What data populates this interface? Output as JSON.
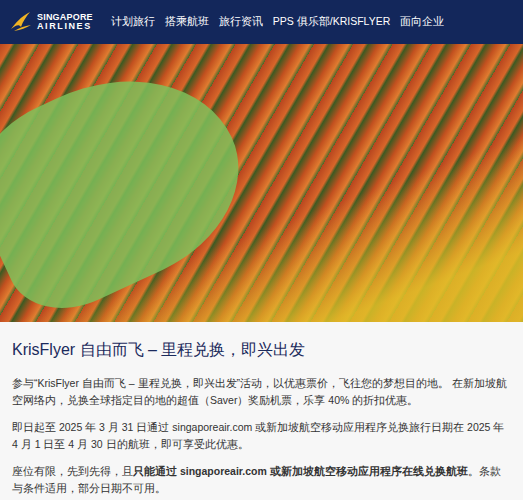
{
  "header": {
    "logo": {
      "line1": "SINGAPORE",
      "line2": "AIRLINES"
    },
    "nav": [
      "计划旅行",
      "搭乘航班",
      "旅行资讯",
      "PPS 俱乐部/KRISFLYER",
      "面向企业"
    ]
  },
  "article": {
    "title": "KrisFlyer 自由而飞 – 里程兑换，即兴出发",
    "paragraphs": [
      [
        {
          "text": "参与“KrisFlyer 自由而飞 – 里程兑换，即兴出发”活动，以优惠票价，飞往您的梦想目的地。 在新加坡航空网络内，兑换全球指定目的地的超值（Saver）奖励机票，乐享 40% 的折扣优惠。",
          "bold": false
        }
      ],
      [
        {
          "text": "即日起至 2025 年 3 月 31 日通过 singaporeair.com 或新加坡航空移动应用程序兑换旅行日期在 2025 年 4 月 1 日至 4 月 30 日的航班，即可享受此优惠。",
          "bold": false
        }
      ],
      [
        {
          "text": "座位有限，先到先得，且",
          "bold": false
        },
        {
          "text": "只能通过 singaporeair.com 或新加坡航空移动应用程序在线兑换航班",
          "bold": true
        },
        {
          "text": "。条款与条件适用，部分日期不可用。",
          "bold": false
        }
      ]
    ]
  }
}
